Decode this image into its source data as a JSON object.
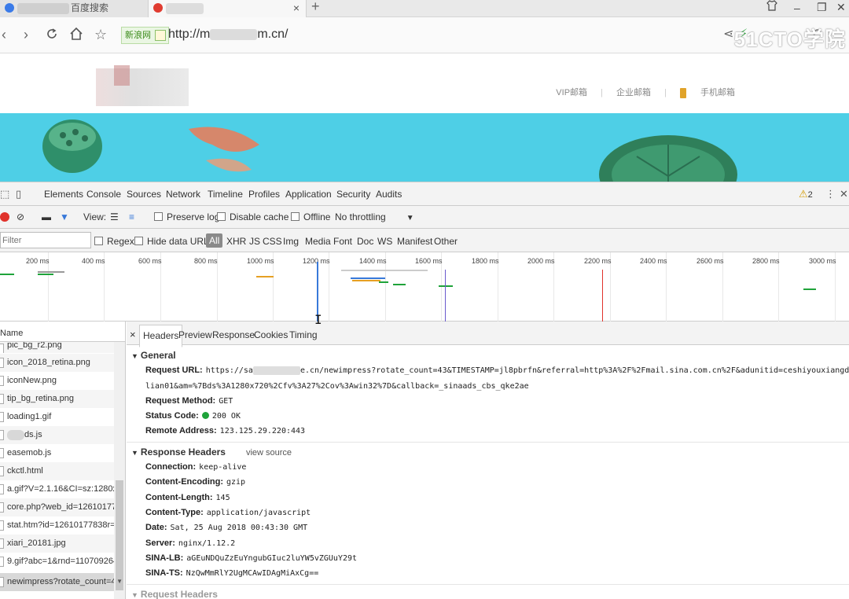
{
  "browser": {
    "tabs": [
      {
        "label": "百度搜索"
      },
      {
        "label": ""
      }
    ],
    "tab_close": "×",
    "new_tab": "+",
    "url_prefix": "http://m",
    "url_suffix": "m.cn/",
    "site_badge": "新浪网",
    "watermark": "51CTO学院"
  },
  "page": {
    "links": [
      "VIP邮箱",
      "企业邮箱",
      "手机邮箱"
    ],
    "separator": "|"
  },
  "devtools": {
    "tabs": [
      "Elements",
      "Console",
      "Sources",
      "Network",
      "Timeline",
      "Profiles",
      "Application",
      "Security",
      "Audits"
    ],
    "active_tab": "Network",
    "warnings": "2",
    "network_toolbar": {
      "view_label": "View:",
      "preserve_log": "Preserve log",
      "disable_cache": "Disable cache",
      "offline": "Offline",
      "throttling": "No throttling"
    },
    "filter": {
      "placeholder": "Filter",
      "regex": "Regex",
      "hide_data_urls": "Hide data URLs",
      "types": [
        "All",
        "XHR",
        "JS",
        "CSS",
        "Img",
        "Media",
        "Font",
        "Doc",
        "WS",
        "Manifest",
        "Other"
      ]
    },
    "timeline_ticks": [
      "200 ms",
      "400 ms",
      "600 ms",
      "800 ms",
      "1000 ms",
      "1200 ms",
      "1400 ms",
      "1600 ms",
      "1800 ms",
      "2000 ms",
      "2200 ms",
      "2400 ms",
      "2600 ms",
      "2800 ms",
      "3000 ms"
    ],
    "name_header": "Name",
    "requests": [
      "pic_bg_r2.png",
      "icon_2018_retina.png",
      "iconNew.png",
      "tip_bg_retina.png",
      "loading1.gif",
      "ds.js",
      "easemob.js",
      "ckctl.html",
      "a.gif?V=2.1.16&CI=sz:1280x7...",
      "core.php?web_id=126101778...",
      "stat.htm?id=12610177838r=...",
      "xiari_20181.jpg",
      "9.gif?abc=1&rnd=1107092649",
      "newimpress?rotate_count=43..."
    ],
    "detail_tabs": [
      "Headers",
      "Preview",
      "Response",
      "Cookies",
      "Timing"
    ],
    "close_glyph": "×",
    "general": {
      "title": "General",
      "request_url_label": "Request URL:",
      "request_url_start": "https://sa",
      "request_url_rest": "e.cn/newimpress?rotate_count=43&TIMESTAMP=jl8pbrfn&referral=http%3A%2F%2Fmail.sina.com.cn%2F&adunitid=ceshiyouxiangdengludui",
      "request_url_line2": "lian01&am=%7Bds%3A1280x720%2Cfv%3A27%2Cov%3Awin32%7D&callback=_sinaads_cbs_qke2ae",
      "method_label": "Request Method:",
      "method": "GET",
      "status_label": "Status Code:",
      "status": "200 OK",
      "remote_label": "Remote Address:",
      "remote": "123.125.29.220:443"
    },
    "response_headers": {
      "title": "Response Headers",
      "view_source": "view source",
      "items": [
        {
          "k": "Connection:",
          "v": "keep-alive"
        },
        {
          "k": "Content-Encoding:",
          "v": "gzip"
        },
        {
          "k": "Content-Length:",
          "v": "145"
        },
        {
          "k": "Content-Type:",
          "v": "application/javascript"
        },
        {
          "k": "Date:",
          "v": "Sat, 25 Aug 2018 00:43:30 GMT"
        },
        {
          "k": "Server:",
          "v": "nginx/1.12.2"
        },
        {
          "k": "SINA-LB:",
          "v": "aGEuNDQuZzEuYngubGIuc2luYW5vZGUuY29t"
        },
        {
          "k": "SINA-TS:",
          "v": "NzQwMmRlY2UgMCAwIDAgMiAxCg=="
        }
      ]
    },
    "request_headers_title": "Request Headers"
  },
  "colors": {
    "banner": "#4ecfe6",
    "accent": "#3879d9",
    "record": "#e0322b",
    "status_ok": "#1fa33a"
  }
}
